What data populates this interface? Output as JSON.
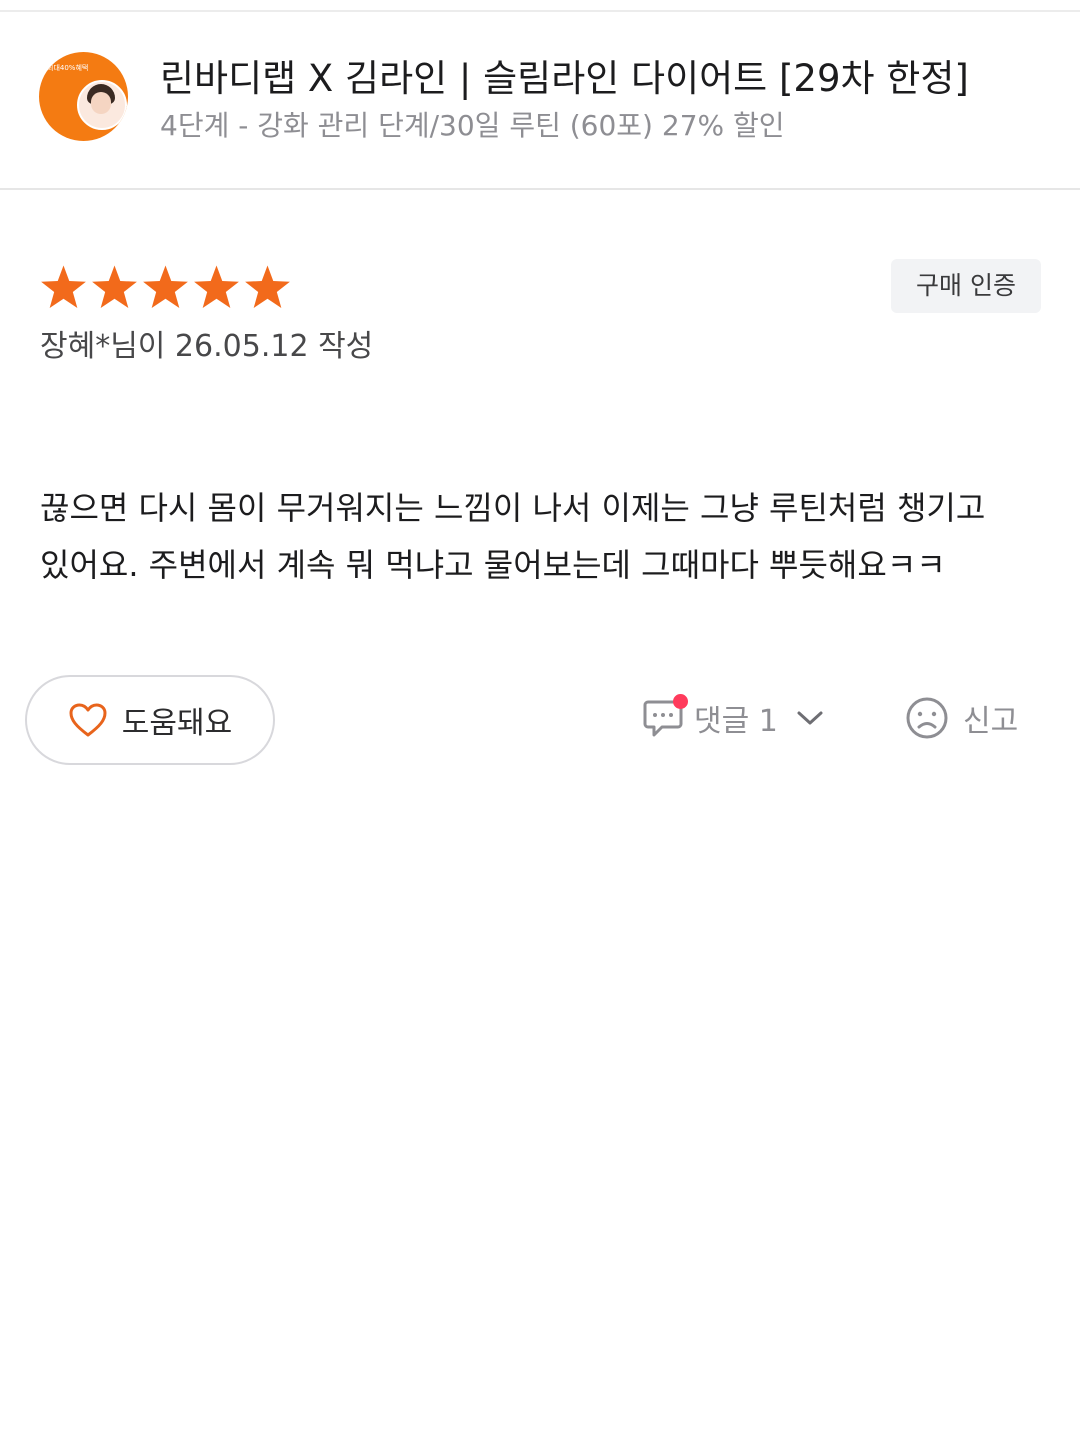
{
  "product": {
    "title": "린바디랩 X 김라인 | 슬림라인 다이어트 [29차 한정]",
    "option": "4단계 - 강화 관리 단계/30일 루틴 (60포) 27% 할인",
    "thumbnail_text": "최대40%혜택",
    "thumbnail_color": "#f47b12"
  },
  "review": {
    "rating": 5,
    "rating_max": 5,
    "star_color": "#f26a1b",
    "verified_label": "구매 인증",
    "meta": "장혜*님이 26.05.12 작성",
    "body": "끊으면 다시 몸이 무거워지는 느낌이 나서 이제는 그냥 루틴처럼 챙기고 있어요. 주변에서 계속 뭐 먹냐고 물어보는데 그때마다 뿌듯해요ㅋㅋ"
  },
  "actions": {
    "helpful_label": "도움돼요",
    "comment_label": "댓글 1",
    "report_label": "신고",
    "heart_color": "#e8641c",
    "notification_dot_color": "#ff3b5c"
  }
}
